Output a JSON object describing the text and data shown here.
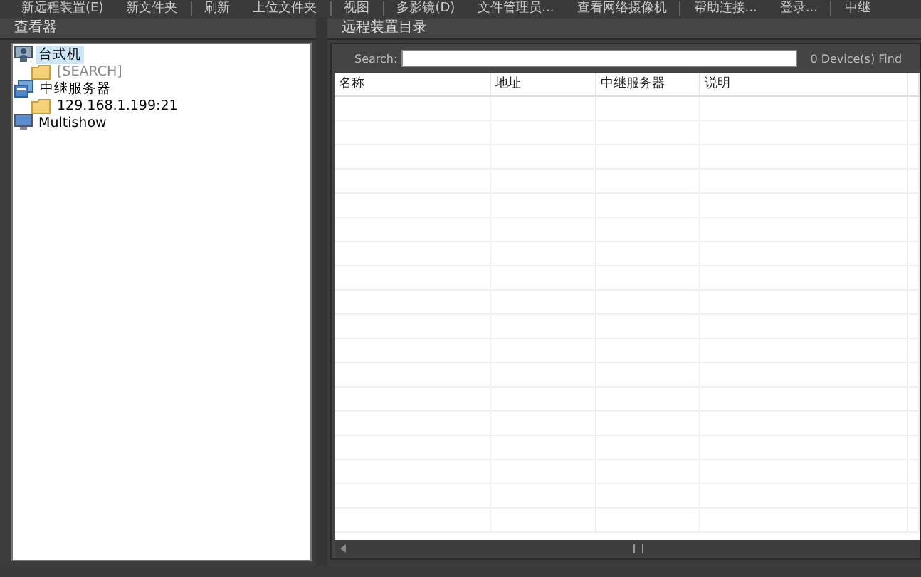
{
  "toolbar": [
    {
      "label": "新远程装置(E)",
      "separator_after": false
    },
    {
      "label": "新文件夹",
      "separator_after": true
    },
    {
      "label": "刷新",
      "separator_after": false
    },
    {
      "label": "上位文件夹",
      "separator_after": true
    },
    {
      "label": "视图",
      "separator_after": true
    },
    {
      "label": "多影镜(D)",
      "separator_after": false
    },
    {
      "label": "文件管理员...",
      "separator_after": false
    },
    {
      "label": "查看网络摄像机",
      "separator_after": true
    },
    {
      "label": "帮助连接...",
      "separator_after": false
    },
    {
      "label": "登录...",
      "separator_after": true
    },
    {
      "label": "中继",
      "separator_after": false
    }
  ],
  "viewer": {
    "title": "查看器",
    "tree": [
      {
        "label": "台式机",
        "kind": "desktop",
        "selected": true,
        "children": [
          {
            "label": "[SEARCH]",
            "kind": "folder",
            "selected": false,
            "disabled": true
          }
        ]
      },
      {
        "label": "中继服务器",
        "kind": "server",
        "selected": false,
        "children": [
          {
            "label": "129.168.1.199:21",
            "kind": "folder",
            "selected": false,
            "disabled": false
          }
        ]
      },
      {
        "label": "Multishow",
        "kind": "monitor",
        "selected": false
      }
    ]
  },
  "directory": {
    "title": "远程装置目录",
    "search": {
      "label": "Search:"
    },
    "count": "0 Device(s) Find",
    "table": {
      "columns": [
        "名称",
        "地址",
        "中继服务器",
        "说明"
      ]
    }
  }
}
